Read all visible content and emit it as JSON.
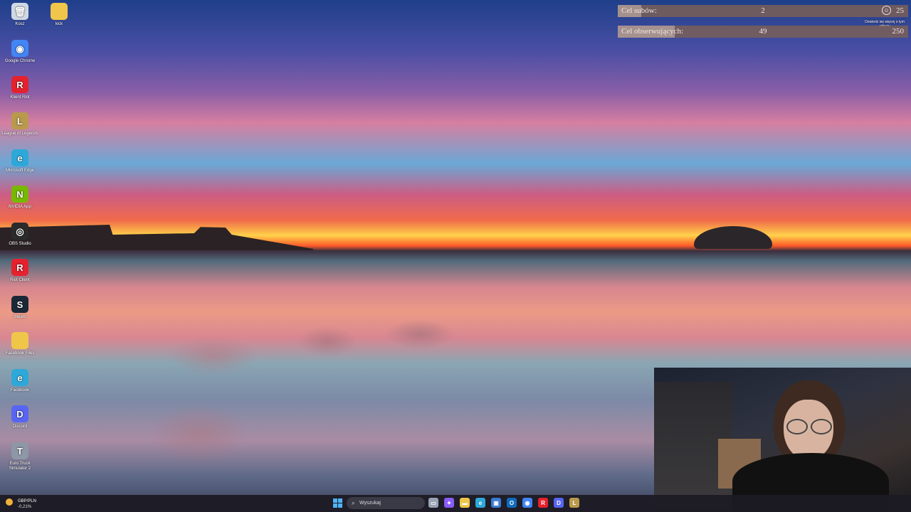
{
  "desktop": {
    "icons": [
      {
        "label": "Kosz",
        "icon": "recycle-bin-icon",
        "color": "#cfd8e3",
        "glyph": "🗑"
      },
      {
        "label": "kick",
        "icon": "folder-icon",
        "color": "#f0c64a",
        "glyph": ""
      },
      {
        "label": "Google Chrome",
        "icon": "chrome-icon",
        "color": "#4285f4",
        "glyph": "◉"
      },
      {
        "label": "Klient Riot",
        "icon": "riot-client-icon",
        "color": "#e4222e",
        "glyph": "R"
      },
      {
        "label": "League of Legends",
        "icon": "league-of-legends-icon",
        "color": "#b99a4c",
        "glyph": "L"
      },
      {
        "label": "Microsoft Edge",
        "icon": "edge-icon",
        "color": "#2ea8d8",
        "glyph": "e"
      },
      {
        "label": "NVIDIA App",
        "icon": "nvidia-icon",
        "color": "#76b900",
        "glyph": "N"
      },
      {
        "label": "OBS Studio",
        "icon": "obs-icon",
        "color": "#2b2b2b",
        "glyph": "◎"
      },
      {
        "label": "Riot Client",
        "icon": "riot-client-icon",
        "color": "#e4222e",
        "glyph": "R"
      },
      {
        "label": "Steam",
        "icon": "steam-icon",
        "color": "#1b2838",
        "glyph": "S"
      },
      {
        "label": "Facebook Files",
        "icon": "folder-icon",
        "color": "#f0c64a",
        "glyph": ""
      },
      {
        "label": "Facebook",
        "icon": "edge-icon",
        "color": "#2ea8d8",
        "glyph": "e"
      },
      {
        "label": "Discord",
        "icon": "discord-icon",
        "color": "#5865f2",
        "glyph": "D"
      },
      {
        "label": "Euro Truck Simulator 2",
        "icon": "euro-truck-icon",
        "color": "#8d97a6",
        "glyph": "T"
      }
    ]
  },
  "goals": {
    "subs": {
      "label": "Cel subów:",
      "current": "2",
      "target": "25",
      "progress": 0.08
    },
    "followers": {
      "label": "Cel obserwujących:",
      "current": "49",
      "target": "250",
      "progress": 0.196
    },
    "learn_more": "Dowiedz się więcej o tym zdjęciu"
  },
  "taskbar": {
    "weather_title": "GBP/PLN",
    "weather_sub": "-0,21%",
    "search_placeholder": "Wyszukaj",
    "apps": [
      {
        "icon": "task-view-icon",
        "color": "#9aa3b5",
        "glyph": "▭"
      },
      {
        "icon": "copilot-icon",
        "color": "#8a5cf6",
        "glyph": "✦"
      },
      {
        "icon": "file-explorer-icon",
        "color": "#f0c64a",
        "glyph": "▬"
      },
      {
        "icon": "edge-icon",
        "color": "#2ea8d8",
        "glyph": "e"
      },
      {
        "icon": "microsoft-store-icon",
        "color": "#3a7bd5",
        "glyph": "▣"
      },
      {
        "icon": "outlook-icon",
        "color": "#0f6cbd",
        "glyph": "O"
      },
      {
        "icon": "chrome-icon",
        "color": "#4285f4",
        "glyph": "◉"
      },
      {
        "icon": "riot-client-icon",
        "color": "#e4222e",
        "glyph": "R"
      },
      {
        "icon": "discord-icon",
        "color": "#5865f2",
        "glyph": "D"
      },
      {
        "icon": "league-of-legends-icon",
        "color": "#b99a4c",
        "glyph": "L"
      }
    ]
  }
}
